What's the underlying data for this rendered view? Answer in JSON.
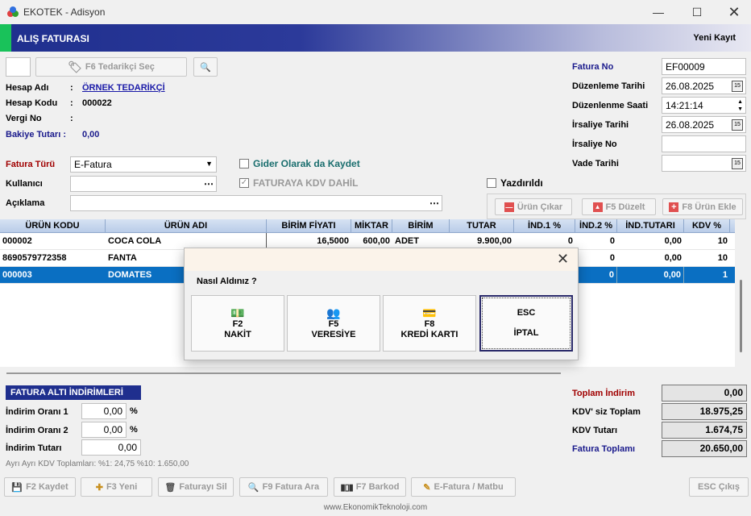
{
  "window": {
    "title": "EKOTEK - Adisyon"
  },
  "header": {
    "title": "ALIŞ FATURASI",
    "mode": "Yeni Kayıt"
  },
  "supplier": {
    "select_button": "F6 Tedarikçi Seç",
    "hesap_adi_label": "Hesap Adı",
    "hesap_adi_value": "ÖRNEK TEDARİKÇİ",
    "hesap_kodu_label": "Hesap Kodu",
    "hesap_kodu_value": "000022",
    "vergi_no_label": "Vergi No",
    "bakiye_label": "Bakiye Tutarı :",
    "bakiye_value": "0,00",
    "colon": ":"
  },
  "invoice": {
    "fatura_no_label": "Fatura No",
    "fatura_no": "EF00009",
    "duzenleme_tarihi_label": "Düzenleme Tarihi",
    "duzenleme_tarihi": "26.08.2025",
    "duzenleme_saati_label": "Düzenlenme Saati",
    "duzenleme_saati": "14:21:14",
    "irsaliye_tarihi_label": "İrsaliye Tarihi",
    "irsaliye_tarihi": "26.08.2025",
    "irsaliye_no_label": "İrsaliye No",
    "vade_tarihi_label": "Vade Tarihi"
  },
  "form": {
    "fatura_turu_label": "Fatura Türü",
    "fatura_turu": "E-Fatura",
    "kullanici_label": "Kullanıcı",
    "aciklama_label": "Açıklama",
    "gider_label": "Gider Olarak da Kaydet",
    "kdv_dahil_label": "FATURAYA KDV DAHİL",
    "yazdirildi_label": "Yazdırıldı"
  },
  "actions": {
    "urun_cikar": "Ürün Çıkar",
    "duzelt": "F5 Düzelt",
    "urun_ekle": "F8 Ürün Ekle"
  },
  "grid": {
    "columns": [
      "ÜRÜN KODU",
      "ÜRÜN ADI",
      "BİRİM FİYATI",
      "MİKTAR",
      "BİRİM",
      "TUTAR",
      "İND.1 %",
      "İND.2 %",
      "İND.TUTARI",
      "KDV %"
    ],
    "rows": [
      [
        "000002",
        "COCA COLA",
        "16,5000",
        "600,00",
        "ADET",
        "9.900,00",
        "0",
        "0",
        "0,00",
        "10"
      ],
      [
        "8690579772358",
        "FANTA",
        "",
        "",
        "",
        "",
        "",
        "0",
        "0,00",
        "10"
      ],
      [
        "000003",
        "DOMATES",
        "",
        "",
        "",
        "",
        "",
        "0",
        "0,00",
        "1"
      ]
    ],
    "selected_row": 2
  },
  "discounts": {
    "title": "FATURA ALTI İNDİRİMLERİ",
    "oran1_label": "İndirim Oranı 1",
    "oran1": "0,00",
    "oran2_label": "İndirim Oranı 2",
    "oran2": "0,00",
    "tutar_label": "İndirim Tutarı",
    "tutar": "0,00",
    "percent": "%",
    "kdv_note": "Ayrı Ayrı KDV Toplamları: %1: 24,75  %10: 1.650,00"
  },
  "totals": {
    "toplam_indirim_label": "Toplam İndirim",
    "toplam_indirim": "0,00",
    "kdvsiz_label": "KDV' siz Toplam",
    "kdvsiz": "18.975,25",
    "kdv_tutari_label": "KDV Tutarı",
    "kdv_tutari": "1.674,75",
    "fatura_toplami_label": "Fatura Toplamı",
    "fatura_toplami": "20.650,00"
  },
  "toolbar": {
    "kaydet": "F2 Kaydet",
    "yeni": "F3 Yeni",
    "sil": "Faturayı Sil",
    "ara": "F9 Fatura Ara",
    "barkod": "F7 Barkod",
    "efatura": "E-Fatura / Matbu",
    "cikis": "ESC Çıkış"
  },
  "footer": {
    "url": "www.EkonomikTeknoloji.com"
  },
  "modal": {
    "question": "Nasıl Aldınız ?",
    "options": [
      {
        "key": "F2",
        "label": "NAKİT",
        "icon": "cash-icon"
      },
      {
        "key": "F5",
        "label": "VERESİYE",
        "icon": "people-icon"
      },
      {
        "key": "F8",
        "label": "KREDİ KARTI",
        "icon": "credit-card-icon"
      },
      {
        "key": "ESC",
        "label": "İPTAL",
        "icon": ""
      }
    ]
  },
  "colors": {
    "header": "#1f2f8e",
    "accent_green": "#19c25a",
    "selection": "#0a6fc2",
    "label_blue": "#1a1a8c",
    "label_red": "#a00000"
  }
}
